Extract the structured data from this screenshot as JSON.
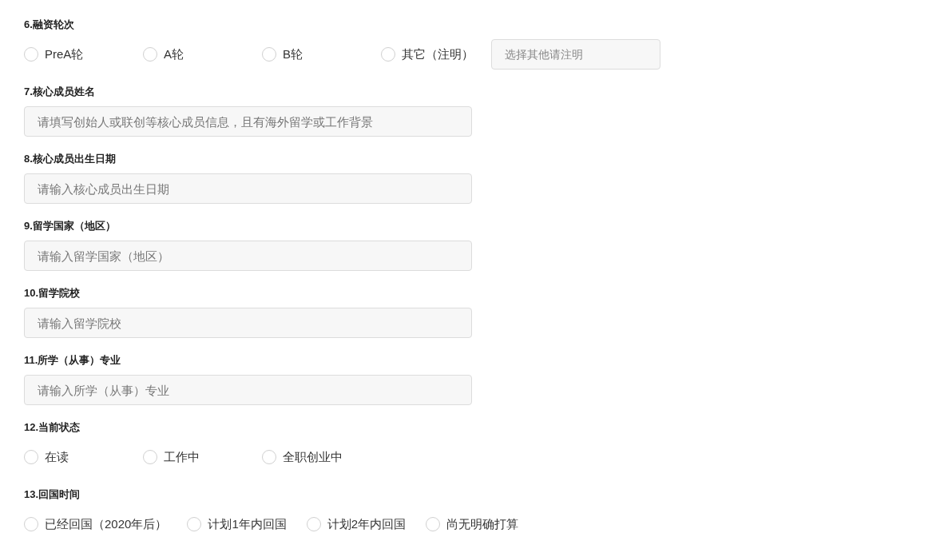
{
  "questions": [
    {
      "kind": "radio",
      "label": "6.融资轮次",
      "options": [
        {
          "label": "PreA轮",
          "selected": false
        },
        {
          "label": "A轮",
          "selected": false
        },
        {
          "label": "B轮",
          "selected": false
        },
        {
          "label": "其它（注明）",
          "selected": false
        }
      ],
      "other_field": {
        "placeholder": "选择其他请注明"
      }
    },
    {
      "kind": "text",
      "label": "7.核心成员姓名",
      "placeholder": "请填写创始人或联创等核心成员信息，且有海外留学或工作背景"
    },
    {
      "kind": "text",
      "label": "8.核心成员出生日期",
      "placeholder": "请输入核心成员出生日期"
    },
    {
      "kind": "text",
      "label": "9.留学国家（地区）",
      "placeholder": "请输入留学国家（地区）"
    },
    {
      "kind": "text",
      "label": "10.留学院校",
      "placeholder": "请输入留学院校"
    },
    {
      "kind": "text",
      "label": "11.所学（从事）专业",
      "placeholder": "请输入所学（从事）专业"
    },
    {
      "kind": "radio",
      "label": "12.当前状态",
      "options": [
        {
          "label": "在读",
          "selected": false
        },
        {
          "label": "工作中",
          "selected": false
        },
        {
          "label": "全职创业中",
          "selected": false
        }
      ]
    },
    {
      "kind": "radio",
      "label": "13.回国时间",
      "options": [
        {
          "label": "已经回国（2020年后）",
          "selected": false
        },
        {
          "label": "计划1年内回国",
          "selected": false
        },
        {
          "label": "计划2年内回国",
          "selected": false
        },
        {
          "label": "尚无明确打算",
          "selected": false
        }
      ]
    }
  ]
}
